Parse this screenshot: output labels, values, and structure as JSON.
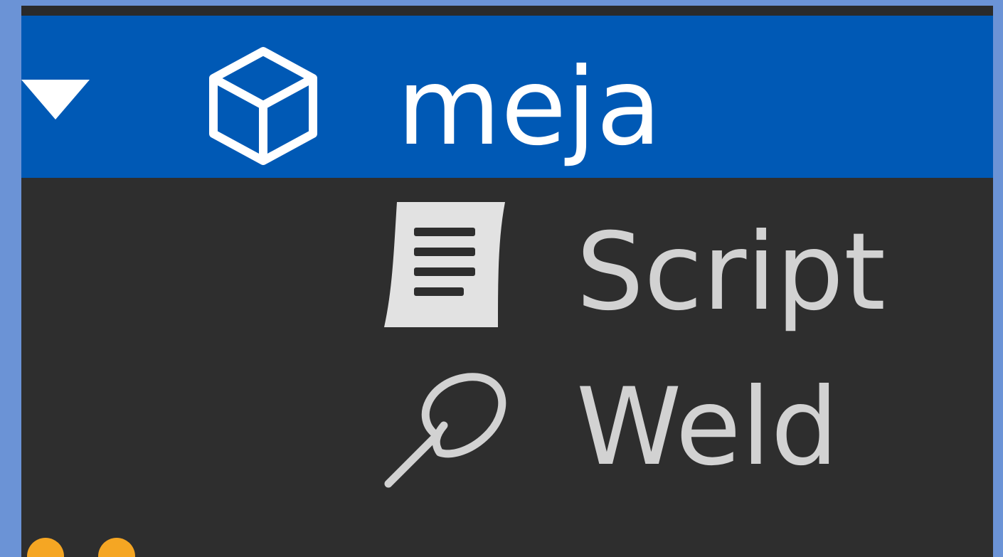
{
  "explorer": {
    "items": [
      {
        "label": "meja",
        "icon": "model-icon",
        "expanded": true,
        "selected": true
      },
      {
        "label": "Script",
        "icon": "script-icon"
      },
      {
        "label": "Weld",
        "icon": "weld-icon"
      }
    ]
  },
  "colors": {
    "selection": "#0059b5",
    "panel_background": "#2e2e2e",
    "window_frame": "#6b93d6",
    "text_selected": "#ffffff",
    "text_normal": "#d2d2d2",
    "partial_icon": "#f5a623"
  }
}
